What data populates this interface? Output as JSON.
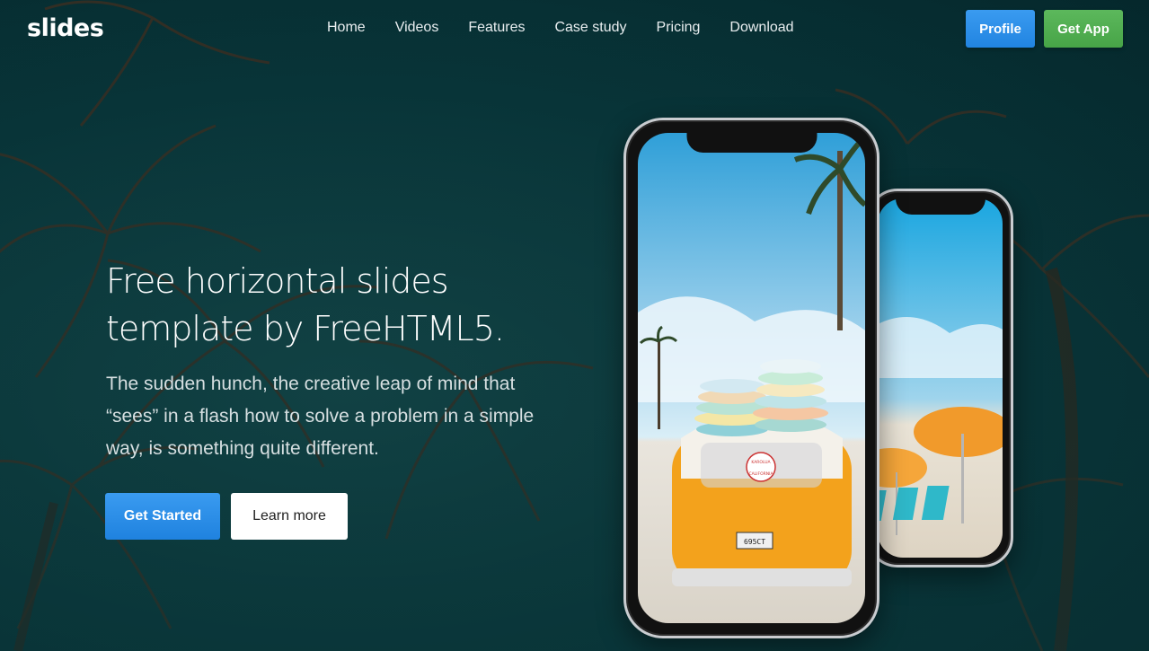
{
  "brand": {
    "logo": "slides"
  },
  "nav": {
    "items": [
      "Home",
      "Videos",
      "Features",
      "Case study",
      "Pricing",
      "Download"
    ]
  },
  "header_buttons": {
    "profile": "Profile",
    "get_app": "Get App"
  },
  "hero": {
    "title_line1": "Free horizontal slides",
    "title_line2": "template by FreeHTML5.",
    "description": "The sudden hunch, the creative leap of mind that “sees” in a flash how to solve a problem in a simple way, is something quite different.",
    "primary_cta": "Get Started",
    "secondary_cta": "Learn more"
  },
  "van": {
    "badge_top": "KAROLUA",
    "badge_bottom": "CALIFORNIA",
    "plate": "695CT"
  },
  "colors": {
    "background": "#0b3a3d",
    "profile_button": "#2a8ee8",
    "get_app_button": "#4cae4c",
    "primary_cta": "#2a8ee8",
    "van": "#f3a21c",
    "umbrella": "#f19a2b"
  }
}
